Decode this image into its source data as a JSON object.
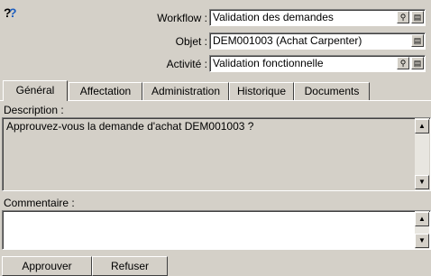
{
  "header": {
    "help_icon": "help-question-icon",
    "workflow_label": "Workflow :",
    "workflow_value": "Validation des demandes",
    "objet_label": "Objet :",
    "objet_value": "DEM001003 (Achat Carpenter)",
    "activite_label": "Activité :",
    "activite_value": "Validation fonctionnelle"
  },
  "tabs": [
    {
      "label": "Général",
      "active": true
    },
    {
      "label": "Affectation"
    },
    {
      "label": "Administration"
    },
    {
      "label": "Historique"
    },
    {
      "label": "Documents"
    }
  ],
  "general": {
    "description_label": "Description :",
    "description_text": "Approuvez-vous la demande d'achat DEM001003 ?",
    "comment_label": "Commentaire :",
    "comment_text": ""
  },
  "actions": {
    "approve_label": "Approuver",
    "reject_label": "Refuser"
  },
  "icons": {
    "search": "magnifier-icon",
    "detail": "detail-icon",
    "scroll_up": "up-arrow-icon",
    "scroll_down": "down-arrow-icon"
  }
}
